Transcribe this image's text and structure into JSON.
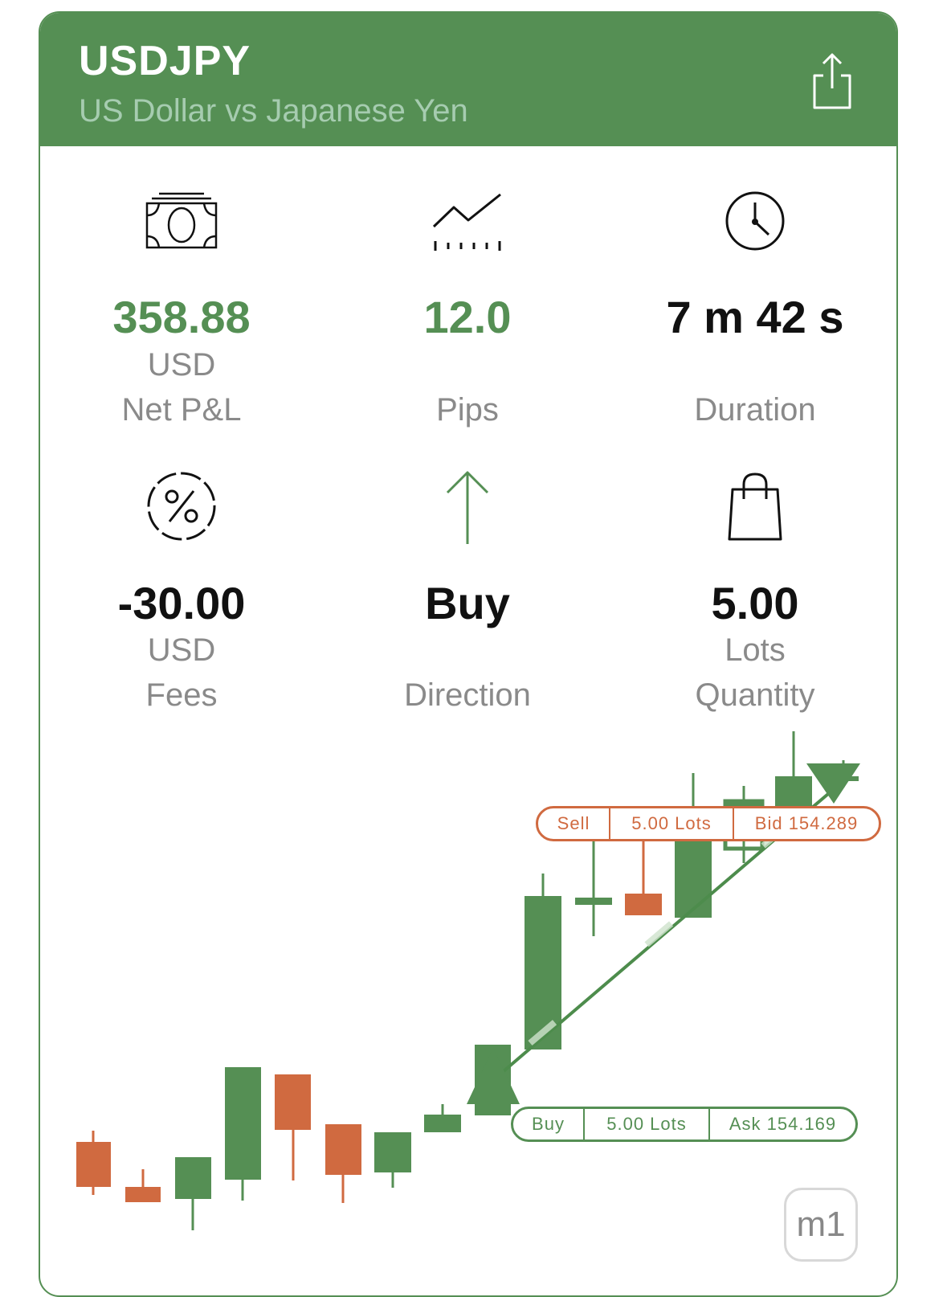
{
  "header": {
    "symbol": "USDJPY",
    "name": "US Dollar vs Japanese Yen",
    "share_icon": "share-icon",
    "bg_color": "#558f54"
  },
  "stats": {
    "net_pnl": {
      "icon": "banknote-icon",
      "value": "358.88",
      "unit": "USD",
      "label": "Net P&L"
    },
    "pips": {
      "icon": "trend-line-icon",
      "value": "12.0",
      "unit": "",
      "label": "Pips"
    },
    "duration": {
      "icon": "clock-icon",
      "value": "7 m 42 s",
      "unit": "",
      "label": "Duration"
    },
    "fees": {
      "icon": "percent-icon",
      "value": "-30.00",
      "unit": "USD",
      "label": "Fees"
    },
    "direction": {
      "icon": "arrow-up-icon",
      "value": "Buy",
      "unit": "",
      "label": "Direction"
    },
    "quantity": {
      "icon": "shopping-bag-icon",
      "value": "5.00",
      "unit": "Lots",
      "label": "Quantity"
    }
  },
  "chart_data": {
    "type": "candlestick",
    "timeframe": "m1",
    "colors": {
      "up": "#558f54",
      "down": "#d06a40"
    },
    "sell_tag": {
      "side": "Sell",
      "lots": "5.00 Lots",
      "price": "Bid 154.289"
    },
    "buy_tag": {
      "side": "Buy",
      "lots": "5.00 Lots",
      "price": "Ask 154.169"
    }
  }
}
